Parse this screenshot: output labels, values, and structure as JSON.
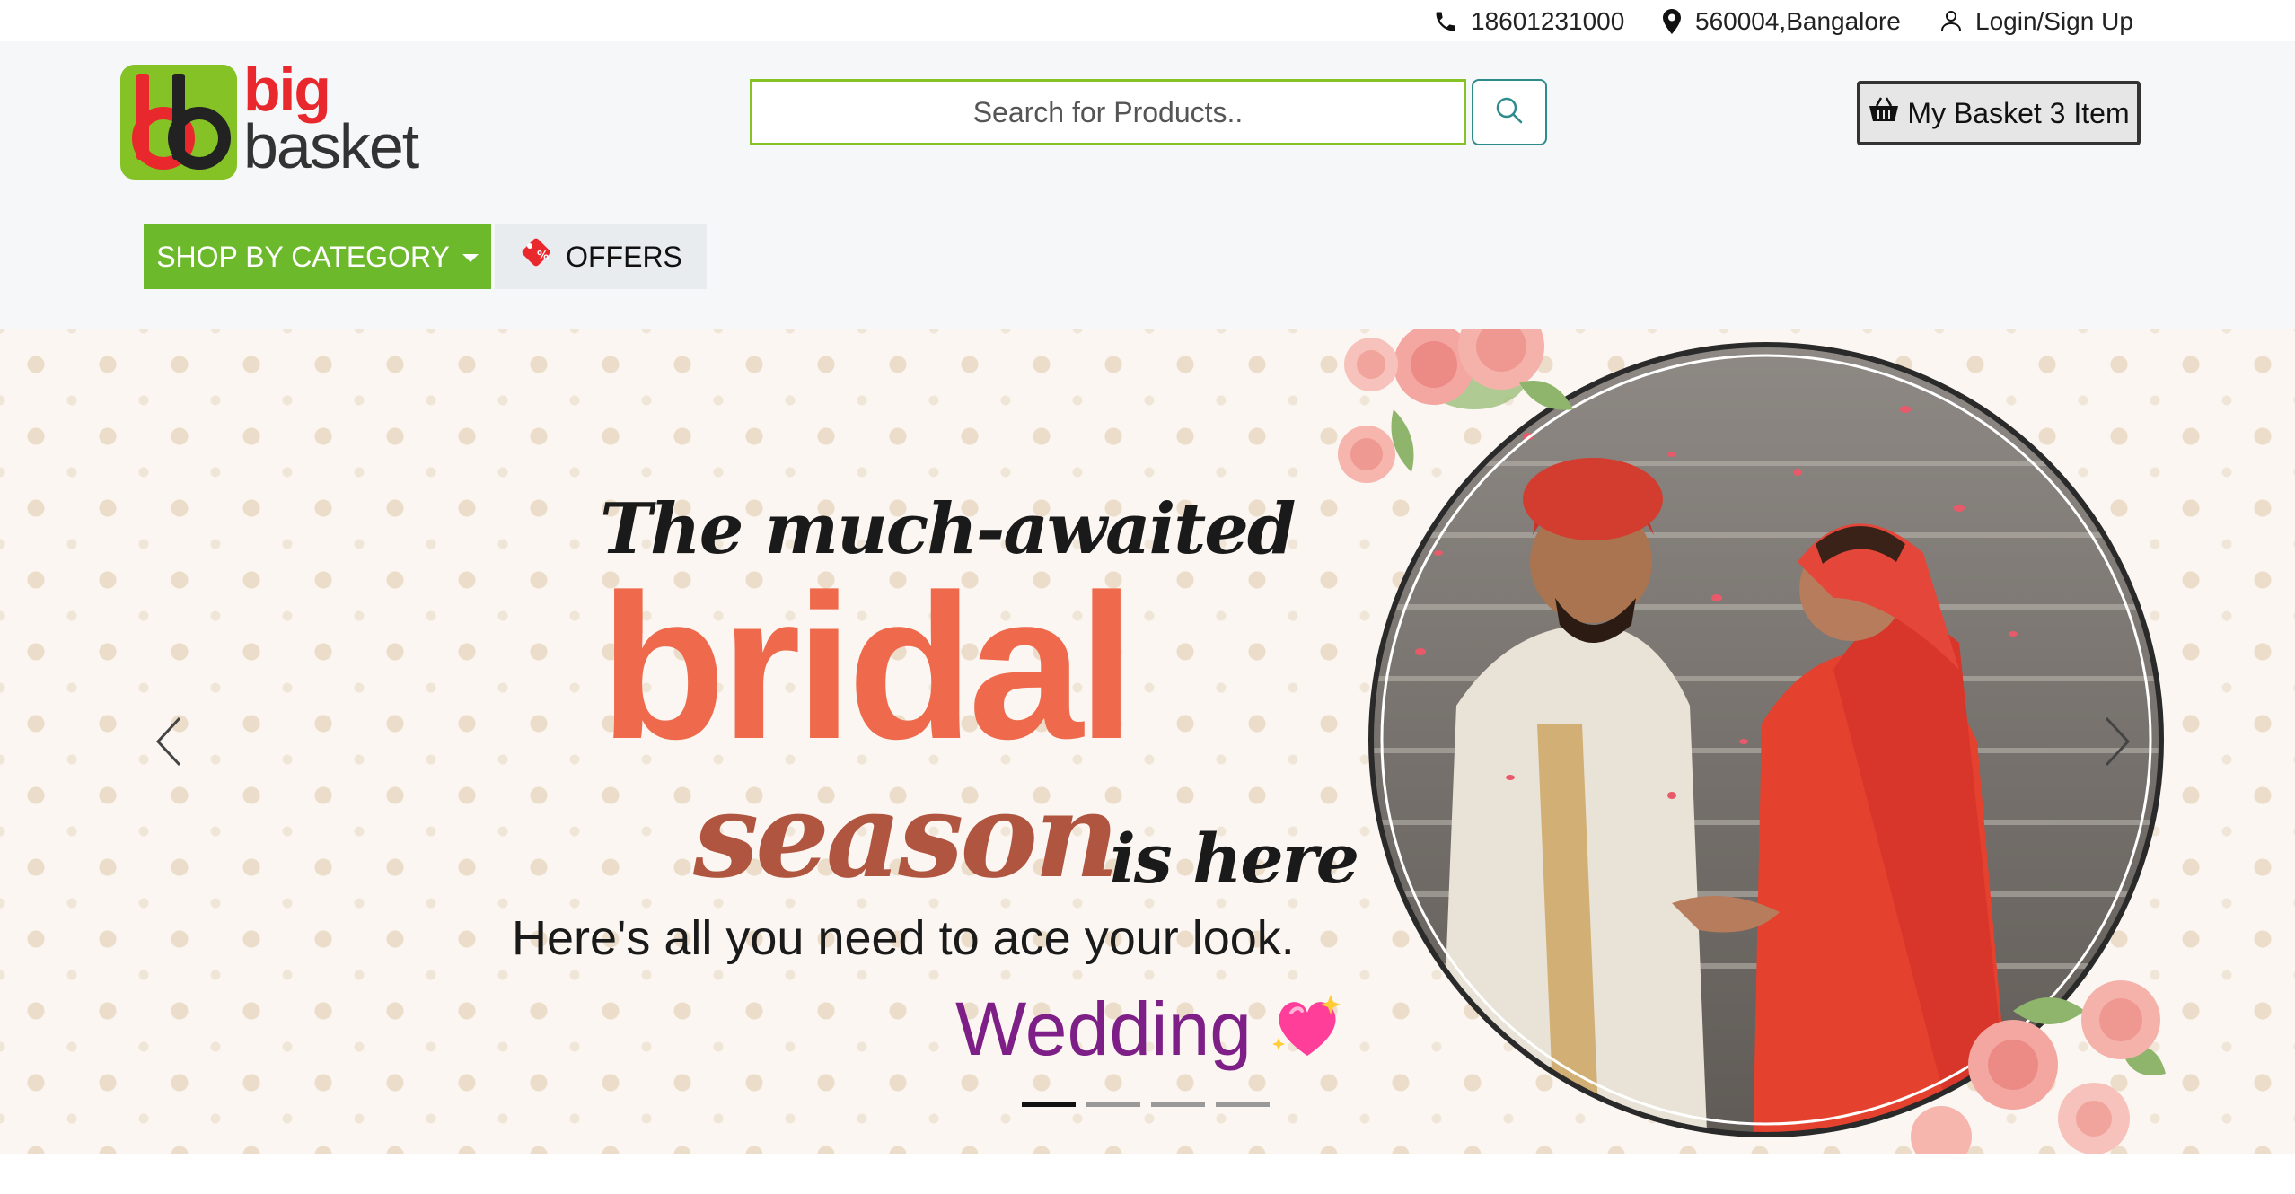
{
  "topbar": {
    "phone": "18601231000",
    "location": "560004,Bangalore",
    "login": "Login/Sign Up"
  },
  "logo": {
    "line1": "big",
    "line2": "basket"
  },
  "search": {
    "placeholder": "Search for Products.."
  },
  "basket": {
    "label": "My Basket 3 Item"
  },
  "nav": {
    "category": "SHOP BY CATEGORY",
    "offers": "OFFERS"
  },
  "banner": {
    "line1": "The much-awaited",
    "line2": "bridal",
    "line3": "season",
    "line4": "is here",
    "line5": "Here's all you need to ace your look.",
    "caption": "Wedding",
    "caption_emoji": "💖",
    "slides_total": 4,
    "active_slide": 1
  },
  "colors": {
    "brand_green": "#84c225",
    "brand_red": "#e8282d",
    "category_green": "#6cba2c",
    "bridal_orange": "#ef6a4c",
    "season_brown": "#b0553f",
    "caption_purple": "#7d1f86"
  },
  "icons": {
    "phone": "phone-icon",
    "location": "location-pin-icon",
    "user": "user-icon",
    "search": "search-icon",
    "basket": "basket-icon",
    "offers": "offer-tag-icon",
    "prev": "chevron-left-icon",
    "next": "chevron-right-icon"
  }
}
